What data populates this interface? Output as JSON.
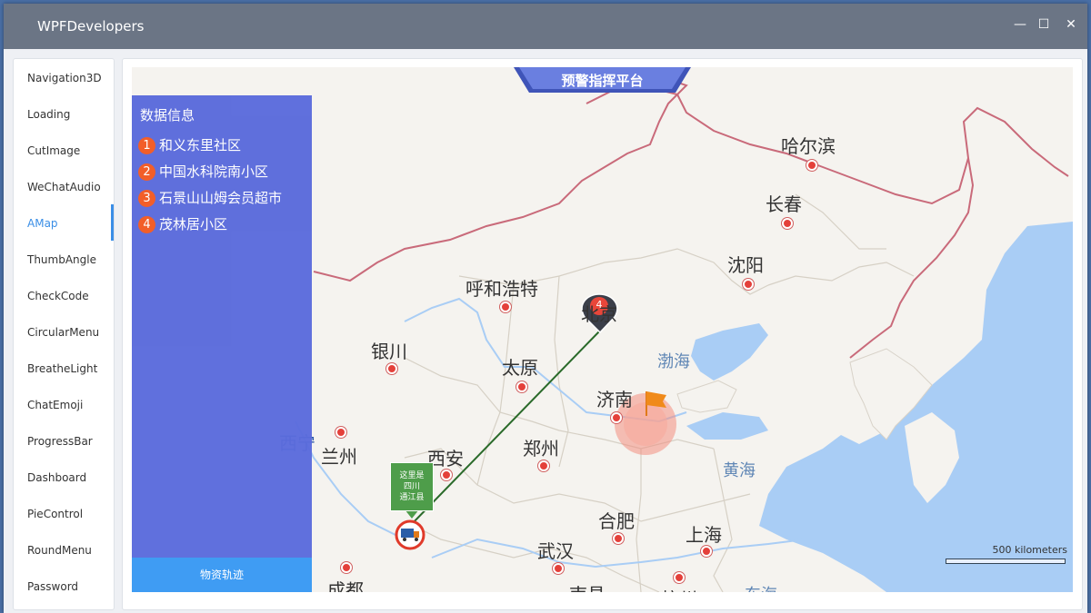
{
  "window": {
    "title": "WPFDevelopers",
    "minimize_icon": "—",
    "maximize_icon": "☐",
    "close_icon": "✕"
  },
  "sidebar": {
    "items": [
      {
        "label": "Navigation3D"
      },
      {
        "label": "Loading"
      },
      {
        "label": "CutImage"
      },
      {
        "label": "WeChatAudio"
      },
      {
        "label": "AMap"
      },
      {
        "label": "ThumbAngle"
      },
      {
        "label": "CheckCode"
      },
      {
        "label": "CircularMenu"
      },
      {
        "label": "BreatheLight"
      },
      {
        "label": "ChatEmoji"
      },
      {
        "label": "ProgressBar"
      },
      {
        "label": "Dashboard"
      },
      {
        "label": "PieControl"
      },
      {
        "label": "RoundMenu"
      },
      {
        "label": "Password"
      }
    ],
    "active": "AMap"
  },
  "map": {
    "banner": "预警指挥平台",
    "panel_title": "数据信息",
    "items": [
      {
        "num": "1",
        "label": "和义东里社区"
      },
      {
        "num": "2",
        "label": "中国水科院南小区"
      },
      {
        "num": "3",
        "label": "石景山山姆会员超市"
      },
      {
        "num": "4",
        "label": "茂林居小区"
      }
    ],
    "track_button": "物资轨迹",
    "marker_number": "4",
    "bubble": {
      "line1": "这里是",
      "line2": "四川",
      "line3": "通江县"
    },
    "scale_label": "500 kilometers",
    "cities": {
      "harbin": "哈尔滨",
      "changchun": "长春",
      "shenyang": "沈阳",
      "hohhot": "呼和浩特",
      "beijing": "北京",
      "yinchuan": "银川",
      "taiyuan": "太原",
      "jinan": "济南",
      "xining": "西宁",
      "lanzhou": "兰州",
      "xian": "西安",
      "zhengzhou": "郑州",
      "hefei": "合肥",
      "shanghai": "上海",
      "wuhan": "武汉",
      "chengdu": "成都",
      "nanchang": "南昌",
      "hangzhou": "杭州"
    },
    "seas": {
      "bohai": "渤海",
      "yellow_sea": "黄海",
      "east_sea": "东海"
    },
    "colors": {
      "panel": "#5b6bdc",
      "track_button": "#3f9cf3",
      "land": "#f5f3ef",
      "water": "#a9cdf5",
      "border": "#c96a7a",
      "route": "#2a6a2a",
      "accent": "#3a8ee6"
    }
  }
}
